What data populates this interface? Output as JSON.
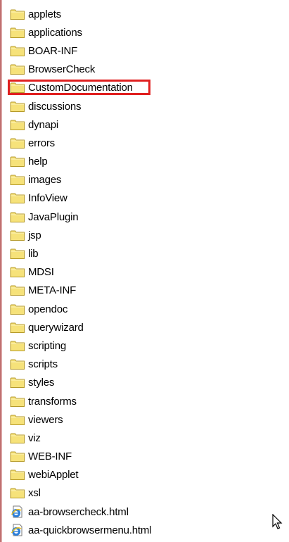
{
  "items": [
    {
      "label": "applets",
      "type": "folder-icon"
    },
    {
      "label": "applications",
      "type": "folder-icon"
    },
    {
      "label": "BOAR-INF",
      "type": "folder-icon"
    },
    {
      "label": "BrowserCheck",
      "type": "folder-icon"
    },
    {
      "label": "CustomDocumentation",
      "type": "folder-icon",
      "highlighted": true
    },
    {
      "label": "discussions",
      "type": "folder-icon"
    },
    {
      "label": "dynapi",
      "type": "folder-icon"
    },
    {
      "label": "errors",
      "type": "folder-icon"
    },
    {
      "label": "help",
      "type": "folder-icon"
    },
    {
      "label": "images",
      "type": "folder-icon"
    },
    {
      "label": "InfoView",
      "type": "folder-icon"
    },
    {
      "label": "JavaPlugin",
      "type": "folder-icon"
    },
    {
      "label": "jsp",
      "type": "folder-icon"
    },
    {
      "label": "lib",
      "type": "folder-icon"
    },
    {
      "label": "MDSI",
      "type": "folder-icon"
    },
    {
      "label": "META-INF",
      "type": "folder-icon"
    },
    {
      "label": "opendoc",
      "type": "folder-icon"
    },
    {
      "label": "querywizard",
      "type": "folder-icon"
    },
    {
      "label": "scripting",
      "type": "folder-icon"
    },
    {
      "label": "scripts",
      "type": "folder-icon"
    },
    {
      "label": "styles",
      "type": "folder-icon"
    },
    {
      "label": "transforms",
      "type": "folder-icon"
    },
    {
      "label": "viewers",
      "type": "folder-icon"
    },
    {
      "label": "viz",
      "type": "folder-icon"
    },
    {
      "label": "WEB-INF",
      "type": "folder-icon"
    },
    {
      "label": "webiApplet",
      "type": "folder-icon"
    },
    {
      "label": "xsl",
      "type": "folder-icon"
    },
    {
      "label": "aa-browsercheck.html",
      "type": "ie-html-icon"
    },
    {
      "label": "aa-quickbrowsermenu.html",
      "type": "ie-html-icon"
    }
  ],
  "colors": {
    "folder_fill": "#f6e27a",
    "folder_stroke": "#b59a2a",
    "highlight_border": "#e02020"
  },
  "cursor_icon": "mouse-pointer-icon"
}
